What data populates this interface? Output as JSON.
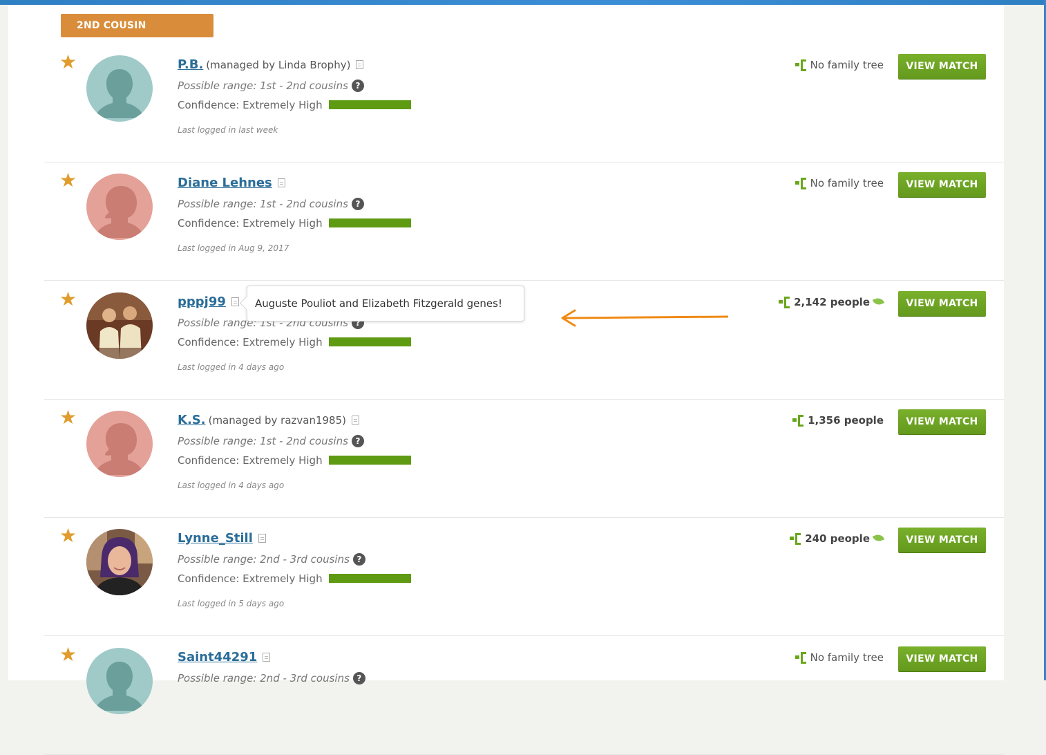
{
  "section": {
    "label": "2ND COUSIN"
  },
  "tooltip": {
    "text": "Auguste Pouliot and Elizabeth Fitzgerald genes!"
  },
  "colors": {
    "section_badge": "#d98d3a",
    "view_button": "#6aa523",
    "confidence_bar": "#5e9a12",
    "star": "#e09c2c",
    "link": "#2a6d98",
    "annotation_arrow": "#f08a16"
  },
  "matches": [
    {
      "name": "P.B.",
      "managed": "(managed by Linda Brophy)",
      "range": "Possible range: 1st - 2nd cousins",
      "confidence": "Confidence: Extremely High",
      "last_login": "Last logged in last week",
      "tree": "No family tree",
      "tree_bold": false,
      "leaf": false,
      "avatar": "silhouette-teal",
      "button": "VIEW MATCH"
    },
    {
      "name": "Diane Lehnes",
      "managed": "",
      "range": "Possible range: 1st - 2nd cousins",
      "confidence": "Confidence: Extremely High",
      "last_login": "Last logged in Aug 9, 2017",
      "tree": "No family tree",
      "tree_bold": false,
      "leaf": false,
      "avatar": "silhouette-female",
      "button": "VIEW MATCH"
    },
    {
      "name": "pppj99",
      "managed": "",
      "range": "Possible range: 1st - 2nd cousins",
      "confidence": "Confidence: Extremely High",
      "last_login": "Last logged in 4 days ago",
      "tree": "2,142 people",
      "tree_bold": true,
      "leaf": true,
      "avatar": "photo-two-men",
      "button": "VIEW MATCH"
    },
    {
      "name": "K.S.",
      "managed": "(managed by razvan1985)",
      "range": "Possible range: 1st - 2nd cousins",
      "confidence": "Confidence: Extremely High",
      "last_login": "Last logged in 4 days ago",
      "tree": "1,356 people",
      "tree_bold": true,
      "leaf": false,
      "avatar": "silhouette-female",
      "button": "VIEW MATCH"
    },
    {
      "name": "Lynne_Still",
      "managed": "",
      "range": "Possible range: 2nd - 3rd cousins",
      "confidence": "Confidence: Extremely High",
      "last_login": "Last logged in 5 days ago",
      "tree": "240 people",
      "tree_bold": true,
      "leaf": true,
      "avatar": "photo-woman",
      "button": "VIEW MATCH"
    },
    {
      "name": "Saint44291",
      "managed": "",
      "range": "Possible range: 2nd - 3rd cousins",
      "confidence": "",
      "last_login": "",
      "tree": "No family tree",
      "tree_bold": false,
      "leaf": false,
      "avatar": "silhouette-teal",
      "button": "VIEW MATCH"
    }
  ]
}
